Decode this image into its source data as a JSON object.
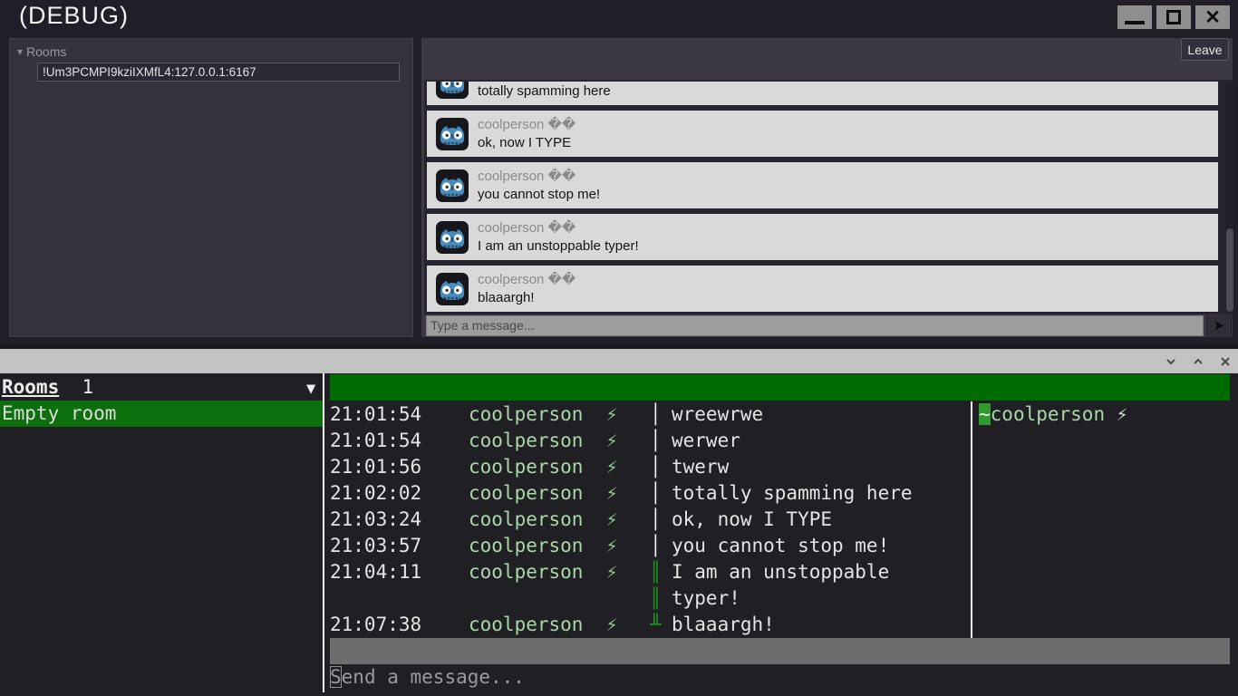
{
  "colors": {
    "gui_window_bg": "#211e28",
    "gui_panel_bg": "#36323d",
    "gui_chat_panel_bg": "#3c3945",
    "message_card_bg": "#d9d9d9",
    "terminal_bg": "#202024",
    "terminal_titlebar_gray": "#c3c3c3",
    "terminal_header_green": "#006b00",
    "terminal_selected_green": "#0c6e0c",
    "terminal_bright_green": "#2f9b2f",
    "terminal_name_green": "#a9d7a9",
    "terminal_gray_bar": "#6d6d6d"
  },
  "gui": {
    "window_title": "(DEBUG)",
    "controls": {
      "minimize": "minimize",
      "maximize": "maximize",
      "close_glyph": "✕"
    },
    "rooms_panel": {
      "tree_arrow": "▾",
      "tree_label": "Rooms",
      "room_id": "!Um3PCMPI9kziIXMfL4:127.0.0.1:6167"
    },
    "chat_panel": {
      "leave_button": "Leave",
      "messages": [
        {
          "sender": "coolperson ��",
          "text": "totally spamming here",
          "partial": true
        },
        {
          "sender": "coolperson ��",
          "text": "ok, now I TYPE"
        },
        {
          "sender": "coolperson ��",
          "text": "you cannot stop me!"
        },
        {
          "sender": "coolperson ��",
          "text": "I am an unstoppable typer!"
        },
        {
          "sender": "coolperson ��",
          "text": "blaaargh!"
        }
      ],
      "input_placeholder": "Type a message...",
      "send_icon": "➤",
      "avatar_name": "godot-robot-avatar"
    }
  },
  "terminal": {
    "sidebar": {
      "header_label": "Rooms",
      "room_count": "1",
      "dropdown_icon": "▼",
      "selected_room": "Empty room"
    },
    "chat": {
      "messages": [
        {
          "time": "21:01:54",
          "sender": "coolperson",
          "badge": "⚡",
          "sep": "│",
          "sep_green": false,
          "text": "wreewrwe"
        },
        {
          "time": "21:01:54",
          "sender": "coolperson",
          "badge": "⚡",
          "sep": "│",
          "sep_green": false,
          "text": "werwer"
        },
        {
          "time": "21:01:56",
          "sender": "coolperson",
          "badge": "⚡",
          "sep": "│",
          "sep_green": false,
          "text": "twerw"
        },
        {
          "time": "21:02:02",
          "sender": "coolperson",
          "badge": "⚡",
          "sep": "│",
          "sep_green": false,
          "text": "totally spamming here"
        },
        {
          "time": "21:03:24",
          "sender": "coolperson",
          "badge": "⚡",
          "sep": "│",
          "sep_green": false,
          "text": "ok, now I TYPE"
        },
        {
          "time": "21:03:57",
          "sender": "coolperson",
          "badge": "⚡",
          "sep": "│",
          "sep_green": false,
          "text": "you cannot stop me!"
        },
        {
          "time": "21:04:11",
          "sender": "coolperson",
          "badge": "⚡",
          "sep": "║\n║",
          "sep_green": true,
          "text": "I am an unstoppable typer!"
        },
        {
          "time": "21:07:38",
          "sender": "coolperson",
          "badge": "⚡",
          "sep": "╨",
          "sep_green": true,
          "text": "blaaargh!"
        }
      ],
      "members": [
        {
          "prefix": "~",
          "name": "coolperson",
          "badge": "⚡"
        }
      ],
      "input_placeholder": "Send a message..."
    }
  }
}
